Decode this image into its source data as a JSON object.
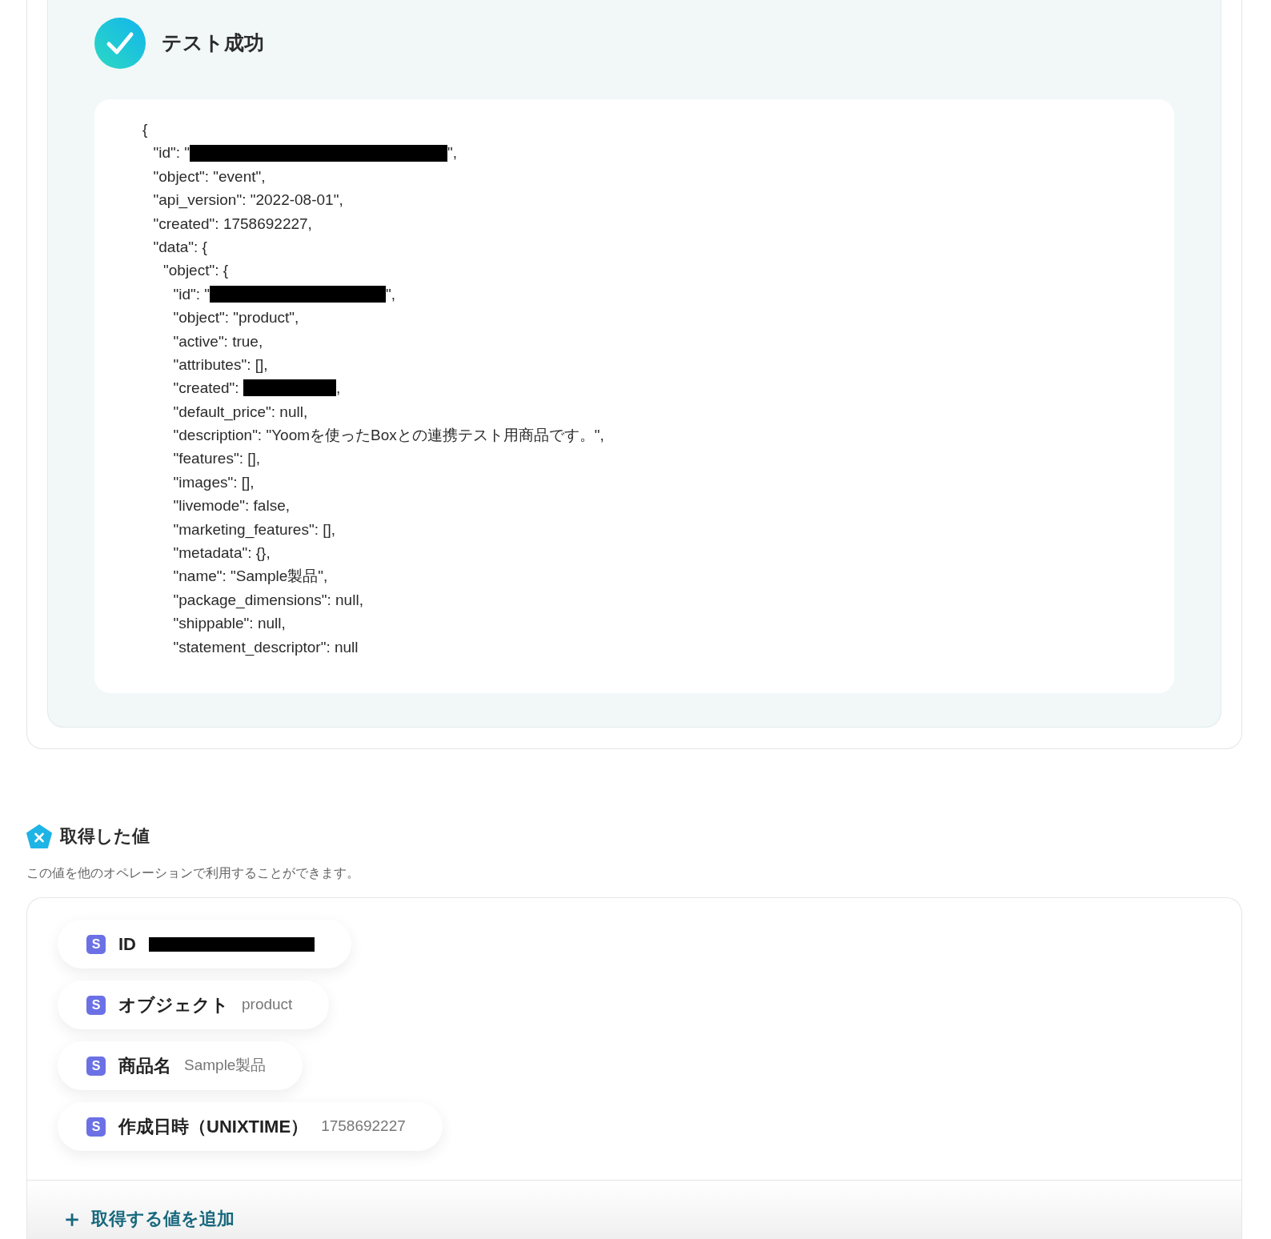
{
  "test_result": {
    "title": "テスト成功",
    "code_lines": [
      {
        "parts": [
          {
            "text": "{"
          }
        ],
        "children": [
          {
            "parts": [
              {
                "text": "\"id\": \""
              },
              {
                "kind": "redaction-long"
              },
              {
                "text": "\","
              }
            ]
          },
          {
            "parts": [
              {
                "text": "\"object\": \"event\","
              }
            ]
          },
          {
            "parts": [
              {
                "text": "\"api_version\": \"2022-08-01\","
              }
            ]
          },
          {
            "parts": [
              {
                "text": "\"created\": 1758692227,"
              }
            ]
          },
          {
            "parts": [
              {
                "text": "\"data\": {"
              }
            ],
            "children": [
              {
                "parts": [
                  {
                    "text": "\"object\": {"
                  }
                ],
                "children": [
                  {
                    "parts": [
                      {
                        "text": "\"id\": \""
                      },
                      {
                        "kind": "redaction-medium"
                      },
                      {
                        "text": "\","
                      }
                    ]
                  },
                  {
                    "parts": [
                      {
                        "text": "\"object\": \"product\","
                      }
                    ]
                  },
                  {
                    "parts": [
                      {
                        "text": "\"active\": true,"
                      }
                    ]
                  },
                  {
                    "parts": [
                      {
                        "text": "\"attributes\": [],"
                      }
                    ]
                  },
                  {
                    "parts": [
                      {
                        "text": "\"created\": "
                      },
                      {
                        "kind": "redaction-short"
                      },
                      {
                        "text": ","
                      }
                    ]
                  },
                  {
                    "parts": [
                      {
                        "text": "\"default_price\": null,"
                      }
                    ]
                  },
                  {
                    "parts": [
                      {
                        "text": "\"description\": \"Yoomを使ったBoxとの連携テスト用商品です。\","
                      }
                    ]
                  },
                  {
                    "parts": [
                      {
                        "text": "\"features\": [],"
                      }
                    ]
                  },
                  {
                    "parts": [
                      {
                        "text": "\"images\": [],"
                      }
                    ]
                  },
                  {
                    "parts": [
                      {
                        "text": "\"livemode\": false,"
                      }
                    ]
                  },
                  {
                    "parts": [
                      {
                        "text": "\"marketing_features\": [],"
                      }
                    ]
                  },
                  {
                    "parts": [
                      {
                        "text": "\"metadata\": {},"
                      }
                    ]
                  },
                  {
                    "parts": [
                      {
                        "text": "\"name\": \"Sample製品\","
                      }
                    ]
                  },
                  {
                    "parts": [
                      {
                        "text": "\"package_dimensions\": null,"
                      }
                    ]
                  },
                  {
                    "parts": [
                      {
                        "text": "\"shippable\": null,"
                      }
                    ]
                  },
                  {
                    "parts": [
                      {
                        "text": "\"statement_descriptor\": null"
                      }
                    ]
                  }
                ]
              }
            ]
          }
        ]
      }
    ]
  },
  "acquired": {
    "title": "取得した値",
    "description": "この値を他のオペレーションで利用することができます。",
    "items": [
      {
        "icon": "S",
        "label": "ID",
        "value": null,
        "redacted": true
      },
      {
        "icon": "S",
        "label": "オブジェクト",
        "value": "product",
        "redacted": false
      },
      {
        "icon": "S",
        "label": "商品名",
        "value": "Sample製品",
        "redacted": false
      },
      {
        "icon": "S",
        "label": "作成日時（UNIXTIME）",
        "value": "1758692227",
        "redacted": false
      }
    ],
    "add_button": {
      "icon": "＋",
      "label": "取得する値を追加"
    }
  }
}
